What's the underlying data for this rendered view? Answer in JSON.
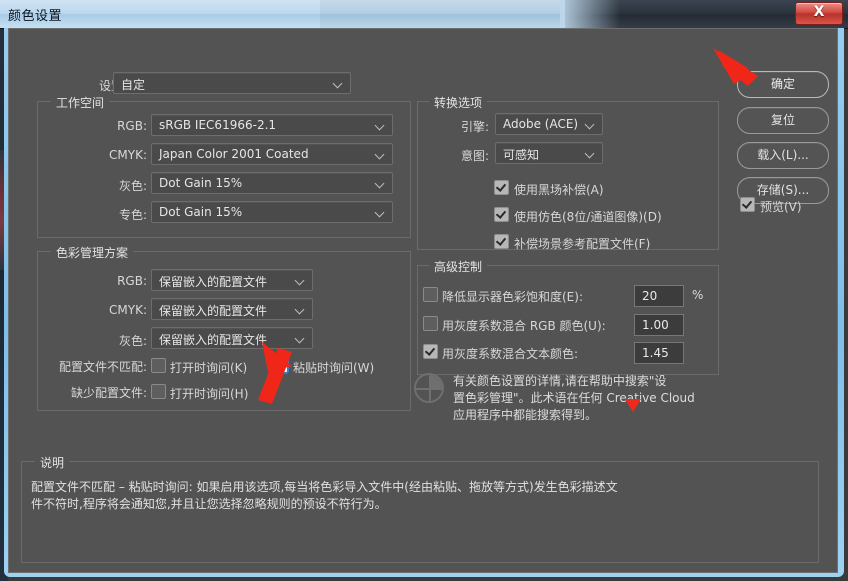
{
  "window": {
    "title": "颜色设置",
    "close_label": "X"
  },
  "settings_row": {
    "label": "设置:",
    "value": "自定"
  },
  "working_spaces": {
    "title": "工作空间",
    "rows": [
      {
        "label": "RGB:",
        "value": "sRGB IEC61966-2.1"
      },
      {
        "label": "CMYK:",
        "value": "Japan Color 2001 Coated"
      },
      {
        "label": "灰色:",
        "value": "Dot Gain 15%"
      },
      {
        "label": "专色:",
        "value": "Dot Gain 15%"
      }
    ]
  },
  "color_management_policies": {
    "title": "色彩管理方案",
    "rows": [
      {
        "label": "RGB:",
        "value": "保留嵌入的配置文件"
      },
      {
        "label": "CMYK:",
        "value": "保留嵌入的配置文件"
      },
      {
        "label": "灰色:",
        "value": "保留嵌入的配置文件"
      }
    ],
    "mismatch_label": "配置文件不匹配:",
    "mismatch_open": {
      "label": "打开时询问(K)",
      "checked": false
    },
    "mismatch_paste": {
      "label": "粘贴时询问(W)",
      "checked": true
    },
    "missing_label": "缺少配置文件:",
    "missing_open": {
      "label": "打开时询问(H)",
      "checked": false
    }
  },
  "conversion_options": {
    "title": "转换选项",
    "engine_label": "引擎:",
    "engine_value": "Adobe (ACE)",
    "intent_label": "意图:",
    "intent_value": "可感知",
    "checks": [
      {
        "label": "使用黑场补偿(A)",
        "checked": true
      },
      {
        "label": "使用仿色(8位/通道图像)(D)",
        "checked": true
      },
      {
        "label": "补偿场景参考配置文件(F)",
        "checked": true
      }
    ]
  },
  "advanced_controls": {
    "title": "高级控制",
    "rows": [
      {
        "label": "降低显示器色彩饱和度(E):",
        "checked": false,
        "value": "20",
        "unit": "%"
      },
      {
        "label": "用灰度系数混合 RGB 颜色(U):",
        "checked": false,
        "value": "1.00",
        "unit": ""
      },
      {
        "label": "用灰度系数混合文本颜色:",
        "checked": true,
        "value": "1.45",
        "unit": ""
      }
    ]
  },
  "note": {
    "line1": "有关颜色设置的详情,请在帮助中搜索\"设",
    "line2": "置色彩管理\"。此术语在任何 Creative Cloud",
    "line3": "应用程序中都能搜索得到。"
  },
  "buttons": {
    "ok": "确定",
    "reset": "复位",
    "load": "载入(L)...",
    "save": "存储(S)...",
    "preview": {
      "label": "预览(V)",
      "checked": true
    }
  },
  "description": {
    "title": "说明",
    "line1": "配置文件不匹配 – 粘贴时询问: 如果启用该选项,每当将色彩导入文件中(经由粘贴、拖放等方式)发生色彩描述文",
    "line2": "件不符时,程序将会通知您,并且让您选择忽略规则的预设不符行为。"
  },
  "annotations": {
    "arrow_ok_color": "#f02718",
    "arrow_checkbox_color": "#f02718",
    "triangle_color": "#ef2a1c"
  },
  "colors": {
    "dialog_bg": "#535353",
    "title_glass": "#bcd8ee",
    "close_red": "#d14a40",
    "accent_blue": "#8dc8ee"
  }
}
